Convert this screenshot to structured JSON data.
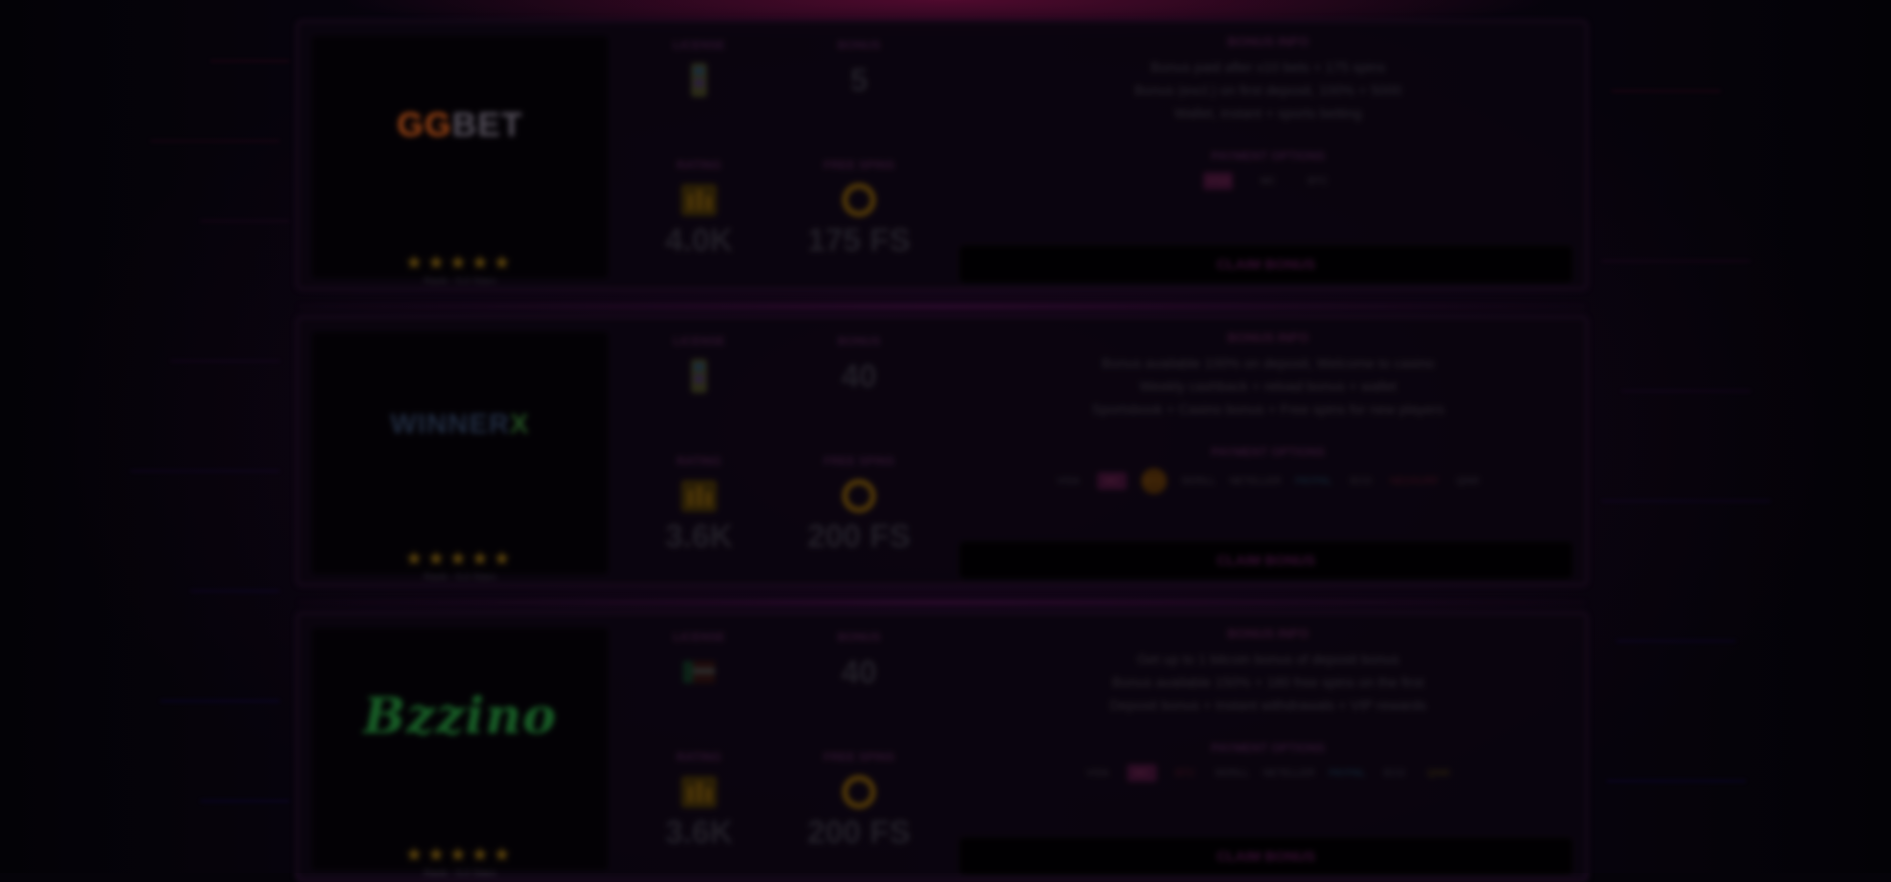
{
  "cards": [
    {
      "logo_a": "GG",
      "logo_b": "BET",
      "stars": "★★★★★",
      "rating": "Rank - 5.0 Stars",
      "stat_labels": [
        "LICENSE",
        "BONUS",
        "RATING",
        "FREE SPINS"
      ],
      "stat_values": [
        "5",
        "4.0K",
        "175 FS"
      ],
      "bonus_title": "BONUS INFO",
      "bonus_lines": [
        "Bonus paid after x10 bets + 175 spins",
        "Bonus (excl.) on first deposit, 100% + 5000",
        "Wallet, instant + sports betting"
      ],
      "pay_title": "PAYMENT OPTIONS",
      "pay": [
        "VISA",
        "MC",
        "BTC"
      ],
      "claim": "CLAIM BONUS"
    },
    {
      "logo_a": "WINNER",
      "logo_b": "X",
      "stars": "★★★★★",
      "rating": "Rank - 5.0 Stars",
      "stat_labels": [
        "LICENSE",
        "BONUS",
        "RATING",
        "FREE SPINS"
      ],
      "stat_values": [
        "40",
        "3.6K",
        "200 FS"
      ],
      "bonus_title": "BONUS INFO",
      "bonus_lines": [
        "Bonus available 100% on deposit, Welcome to casino",
        "Weekly cashback + reload bonus + wallet",
        "Sportsbook + Casino bonus + Free spins for new players"
      ],
      "pay_title": "PAYMENT OPTIONS",
      "pay": [
        "VISA",
        "MC",
        "BTC",
        "SKRILL",
        "NETELLER",
        "PAYPAL",
        "ECO",
        "NEOSURF",
        "QIWI"
      ],
      "claim": "CLAIM BONUS"
    },
    {
      "logo_a": "Bz",
      "logo_b": "zino",
      "stars": "★★★★★",
      "rating": "Rank - 5.0 Stars",
      "stat_labels": [
        "LICENSE",
        "BONUS",
        "RATING",
        "FREE SPINS"
      ],
      "stat_values": [
        "40",
        "3.6K",
        "200 FS"
      ],
      "bonus_title": "BONUS INFO",
      "bonus_lines": [
        "Get up to 1 bitcoin bonus of deposit bonus",
        "Bonus available 150% + 180 free spins on the first",
        "Deposit bonus + Instant withdrawals + VIP rewards"
      ],
      "pay_title": "PAYMENT OPTIONS",
      "pay": [
        "VISA",
        "MC",
        "BTC",
        "SKRILL",
        "NETELLER",
        "PAYPAL",
        "ECO",
        "QIWI"
      ],
      "claim": "CLAIM BONUS"
    }
  ],
  "colors": {
    "accent": "#4a1545",
    "star": "#7a5a10",
    "ring": "#7a5a10"
  }
}
